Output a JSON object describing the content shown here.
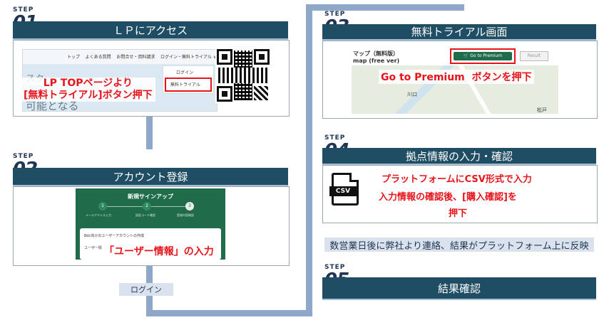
{
  "step_word": "STEP",
  "steps": {
    "s1": {
      "num": "01",
      "title": "ＬＰにアクセス",
      "nav": [
        "トップ",
        "よくある質問",
        "お問合せ・資料請求",
        "ログイン・無料トライアル ∨"
      ],
      "menu_login": "ログイン",
      "menu_trial": "無料トライアル",
      "bg_text_1": "スク",
      "bg_text_2": "可能となる",
      "caption_1": "LP TOPページより",
      "caption_2": "[無料トライアル]ボタン押下"
    },
    "s2": {
      "num": "02",
      "title": "アカウント登録",
      "signup_title": "新規サインアップ",
      "step_labels": [
        "メールアドレス入力",
        "認証コード確認",
        "登録内容確認"
      ],
      "form_line_1": "Bdc向けのユーザーアカウントの作成",
      "form_line_2": "ユーザー情",
      "caption": "「ユーザー情報」の入力"
    },
    "s3": {
      "num": "03",
      "title": "無料トライアル画面",
      "map_title_1": "マップ（無料版）",
      "map_title_2": "map (free ver)",
      "premium_btn": "Go to Premium",
      "result_btn": "Result",
      "places": [
        "川口",
        "松戸"
      ],
      "caption": "Go to Premium  ボタンを押下"
    },
    "s4": {
      "num": "04",
      "title": "拠点情報の入力・確認",
      "csv_label": "CSV",
      "caption_1": "プラットフォームにCSV形式で入力",
      "caption_2": "入力情報の確認後、[購入確認]を",
      "caption_3": "押下"
    },
    "s5": {
      "num": "05",
      "title": "結果確認"
    }
  },
  "notes": {
    "login": "ログイン",
    "contact": "数営業日後に弊社より連絡、結果がプラットフォーム上に反映"
  },
  "colors": {
    "bar": "#1f4e64",
    "accent_red": "#e8141b",
    "flow": "#8fa7c9",
    "signup_green": "#1f6b4a"
  }
}
